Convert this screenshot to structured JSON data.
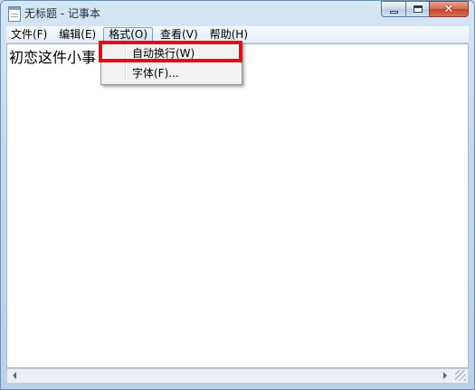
{
  "window": {
    "title": "无标题 - 记事本",
    "icon": "notepad-icon",
    "controls": [
      "minimize-icon",
      "maximize-icon",
      "close-icon"
    ]
  },
  "menubar": {
    "items": [
      {
        "label": "文件(F)"
      },
      {
        "label": "编辑(E)"
      },
      {
        "label": "格式(O)"
      },
      {
        "label": "查看(V)"
      },
      {
        "label": "帮助(H)"
      }
    ],
    "active_index": 2
  },
  "format_menu": {
    "items": [
      {
        "label": "自动换行(W)",
        "highlighted": true
      },
      {
        "label": "字体(F)..."
      }
    ]
  },
  "editor": {
    "text": "初恋这件小事"
  },
  "colors": {
    "highlight": "#e40c14",
    "menu_active_border": "#7da2ce"
  }
}
